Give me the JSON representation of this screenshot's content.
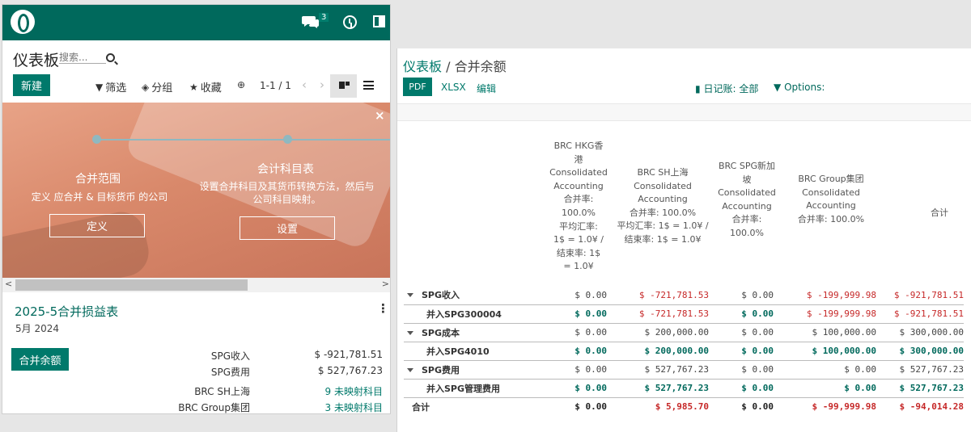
{
  "mobile": {
    "chat_badge": "3",
    "page_title": "仪表板",
    "search_placeholder": "搜索...",
    "new_label": "新建",
    "filter_label": "筛选",
    "group_label": "分组",
    "favorite_label": "收藏",
    "pager": "1-1 / 1",
    "banner": {
      "close": "×",
      "step1_title": "合并范围",
      "step1_desc": "定义 应合并 & 目标货币 的公司",
      "step1_button": "定义",
      "step2_title": "会计科目表",
      "step2_desc_1": "设置合并科目及其货币转换方法，然后与",
      "step2_desc_2": "公司科目映射。",
      "step2_button": "设置"
    },
    "card": {
      "title": "2025-5合并损益表",
      "subtitle": "5月 2024",
      "button": "合并余额",
      "rows": [
        {
          "label": "SPG收入",
          "value": "$ -921,781.51"
        },
        {
          "label": "SPG费用",
          "value": "$ 527,767.23"
        },
        {
          "label": "BRC SH上海",
          "value": "9 未映射科目"
        },
        {
          "label": "BRC Group集团",
          "value": "3 未映射科目"
        }
      ]
    }
  },
  "report": {
    "breadcrumb_link": "仪表板",
    "breadcrumb_sep": "/",
    "breadcrumb_current": "合并余额",
    "pdf": "PDF",
    "xlsx": "XLSX",
    "edit": "编辑",
    "journal_label": "日记账:",
    "journal_value": "全部",
    "options_label": "Options:",
    "columns": [
      {
        "lines": [
          "BRC HKG香",
          "港",
          "Consolidated",
          "Accounting",
          "合并率:",
          "100.0%",
          "平均汇率:",
          "1$ = 1.0¥ /",
          "结束率:  1$",
          "= 1.0¥"
        ]
      },
      {
        "lines": [
          "BRC SH上海",
          "Consolidated",
          "Accounting",
          "合并率:  100.0%",
          "平均汇率:  1$ = 1.0¥ /",
          "结束率:  1$ = 1.0¥"
        ]
      },
      {
        "lines": [
          "BRC SPG新加",
          "坡",
          "Consolidated",
          "Accounting",
          "合并率:",
          "100.0%"
        ]
      },
      {
        "lines": [
          "BRC Group集团",
          "Consolidated",
          "Accounting",
          "合并率:  100.0%"
        ]
      },
      {
        "lines": [
          "合计"
        ]
      }
    ],
    "rows": [
      {
        "label": "SPG收入",
        "level": 0,
        "values": [
          "$ 0.00",
          "$ -721,781.53",
          "$ 0.00",
          "$ -199,999.98",
          "$ -921,781.51"
        ]
      },
      {
        "label": "并入SPG300004",
        "level": 1,
        "values": [
          "$ 0.00",
          "$ -721,781.53",
          "$ 0.00",
          "$ -199,999.98",
          "$ -921,781.51"
        ]
      },
      {
        "label": "SPG成本",
        "level": 0,
        "values": [
          "$ 0.00",
          "$ 200,000.00",
          "$ 0.00",
          "$ 100,000.00",
          "$ 300,000.00"
        ]
      },
      {
        "label": "并入SPG4010",
        "level": 1,
        "values": [
          "$ 0.00",
          "$ 200,000.00",
          "$ 0.00",
          "$ 100,000.00",
          "$ 300,000.00"
        ]
      },
      {
        "label": "SPG费用",
        "level": 0,
        "values": [
          "$ 0.00",
          "$ 527,767.23",
          "$ 0.00",
          "$ 0.00",
          "$ 527,767.23"
        ]
      },
      {
        "label": "并入SPG管理费用",
        "level": 1,
        "values": [
          "$ 0.00",
          "$ 527,767.23",
          "$ 0.00",
          "$ 0.00",
          "$ 527,767.23"
        ]
      },
      {
        "label": "合计",
        "level": 2,
        "values": [
          "$ 0.00",
          "$ 5,985.70",
          "$ 0.00",
          "$ -99,999.98",
          "$ -94,014.28"
        ]
      }
    ]
  },
  "colors": {
    "brand": "#00695c",
    "link": "#00796b",
    "negative": "#c62828"
  }
}
